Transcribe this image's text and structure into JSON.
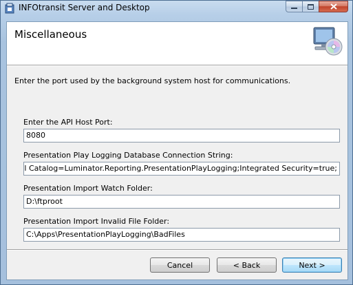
{
  "window": {
    "title": "INFOtransit Server and Desktop"
  },
  "header": {
    "title": "Miscellaneous"
  },
  "description": "Enter the port used by the background system host for communications.",
  "fields": [
    {
      "label": "Enter the API Host Port:",
      "value": "8080"
    },
    {
      "label": "Presentation Play Logging Database Connection String:",
      "value": "SERVER=.;Initial Catalog=Luminator.Reporting.PresentationPlayLogging;Integrated Security=true;"
    },
    {
      "label": "Presentation Import Watch Folder:",
      "value": "D:\\ftproot"
    },
    {
      "label": "Presentation Import Invalid File Folder:",
      "value": "C:\\Apps\\PresentationPlayLogging\\BadFiles"
    }
  ],
  "buttons": {
    "cancel": "Cancel",
    "back": "< Back",
    "next": "Next >"
  }
}
